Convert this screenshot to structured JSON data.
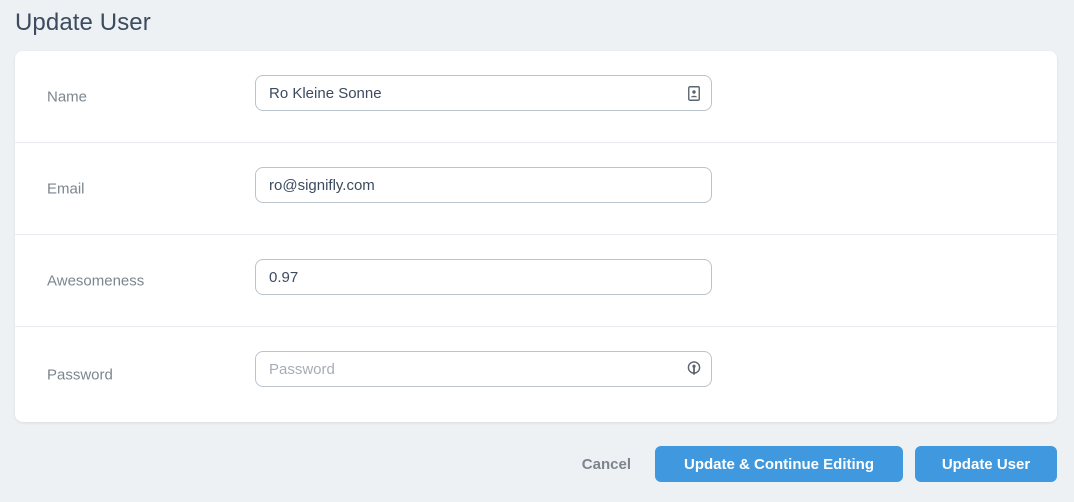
{
  "page": {
    "title": "Update User"
  },
  "form": {
    "fields": [
      {
        "label": "Name",
        "value": "Ro Kleine Sonne",
        "placeholder": "",
        "icon": "contact-card-icon"
      },
      {
        "label": "Email",
        "value": "ro@signifly.com",
        "placeholder": "",
        "icon": ""
      },
      {
        "label": "Awesomeness",
        "value": "0.97",
        "placeholder": "",
        "icon": ""
      },
      {
        "label": "Password",
        "value": "",
        "placeholder": "Password",
        "icon": "key-icon"
      }
    ]
  },
  "actions": {
    "cancel_label": "Cancel",
    "continue_label": "Update & Continue Editing",
    "submit_label": "Update User"
  },
  "colors": {
    "background": "#eef1f4",
    "primary": "#4099de",
    "label": "#7c858e",
    "text": "#3c4b5f",
    "border": "#bac4cc"
  }
}
